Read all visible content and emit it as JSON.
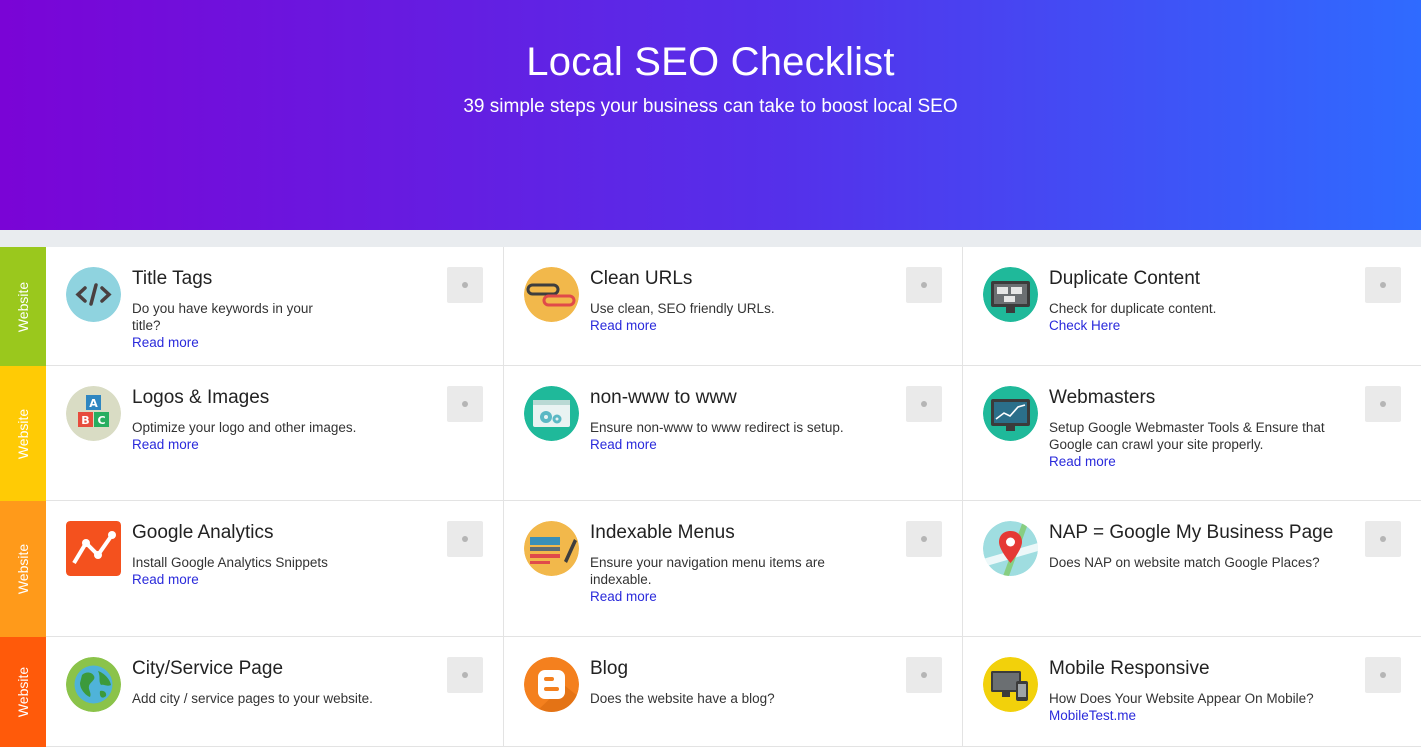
{
  "header": {
    "title": "Local SEO Checklist",
    "subtitle": "39 simple steps your business can take to boost local SEO"
  },
  "colors": {
    "row1": "#9ac81d",
    "row2": "#ffcb05",
    "row3": "#ff9a1a",
    "row4": "#ff5a0a",
    "link": "#2a2adb"
  },
  "rows": [
    {
      "label": "Website",
      "items": [
        {
          "title": "Title Tags",
          "desc": "Do you have keywords in your title?",
          "link": "Read more",
          "icon": "code-icon"
        },
        {
          "title": "Clean URLs",
          "desc": "Use clean, SEO friendly URLs.",
          "link": "Read more",
          "icon": "chain-link-icon"
        },
        {
          "title": "Duplicate Content",
          "desc": "Check for duplicate content.",
          "link": "Check Here",
          "icon": "duplicate-screens-icon"
        }
      ]
    },
    {
      "label": "Website",
      "items": [
        {
          "title": "Logos & Images",
          "desc": "Optimize your logo and other images.",
          "link": "Read more",
          "icon": "abc-blocks-icon"
        },
        {
          "title": "non-www to www",
          "desc": "Ensure non-www to www redirect is setup.",
          "link": "Read more",
          "icon": "browser-gear-icon"
        },
        {
          "title": "Webmasters",
          "desc": "Setup Google Webmaster Tools & Ensure that Google can crawl your site properly.",
          "link": "Read more",
          "icon": "monitor-chart-icon"
        }
      ]
    },
    {
      "label": "Website",
      "items": [
        {
          "title": "Google Analytics",
          "desc": "Install Google Analytics Snippets",
          "link": "Read more",
          "icon": "analytics-icon"
        },
        {
          "title": "Indexable Menus",
          "desc": "Ensure your navigation menu items are indexable.",
          "link": "Read more",
          "icon": "menu-pen-icon"
        },
        {
          "title": "NAP = Google My Business Page",
          "desc": "Does NAP on website match Google Places?",
          "link": "",
          "icon": "map-pin-icon"
        }
      ]
    },
    {
      "label": "Website",
      "items": [
        {
          "title": "City/Service Page",
          "desc": "Add city / service pages to your website.",
          "link": "",
          "icon": "globe-icon"
        },
        {
          "title": "Blog",
          "desc": "Does the website have a blog?",
          "link": "",
          "icon": "blogger-icon"
        },
        {
          "title": "Mobile Responsive",
          "desc": "How Does Your Website Appear On Mobile?",
          "link": "MobileTest.me",
          "icon": "devices-icon"
        }
      ]
    }
  ]
}
